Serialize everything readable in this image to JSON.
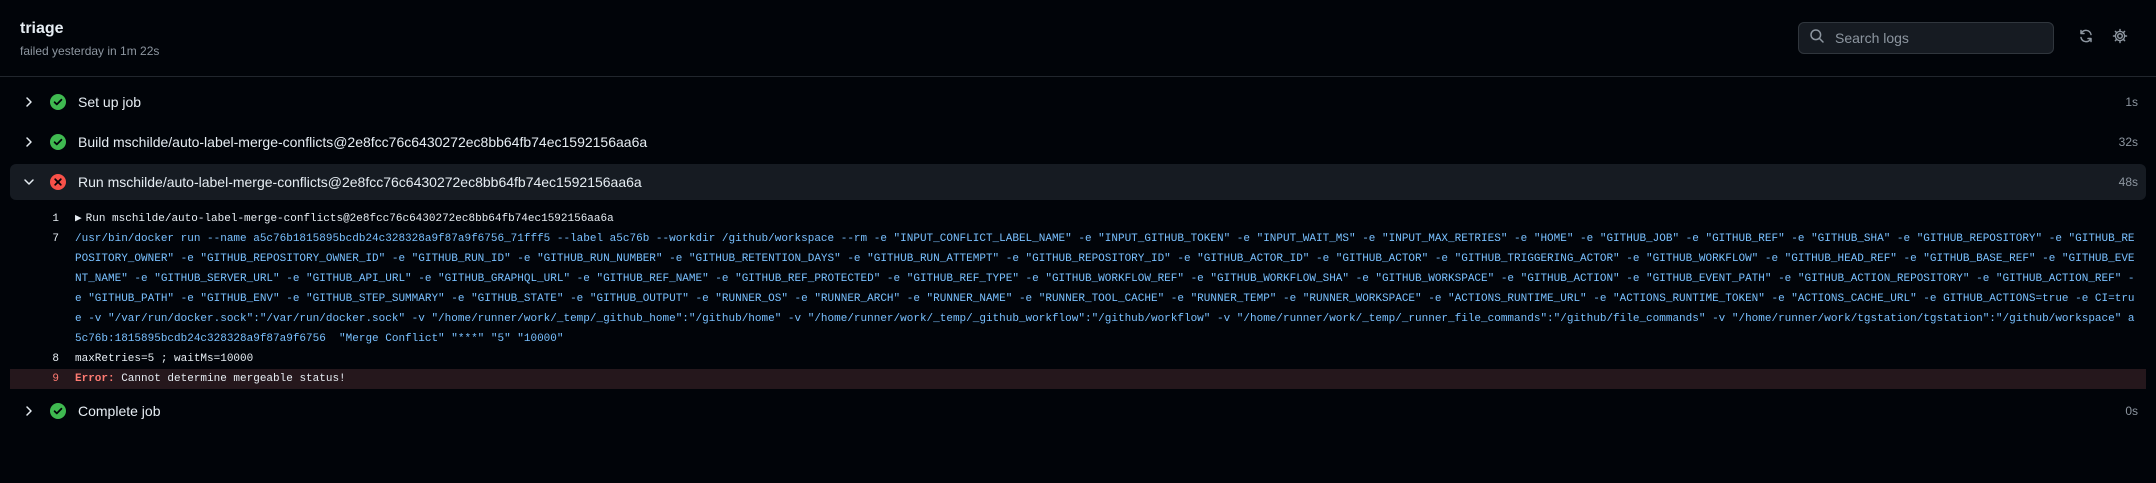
{
  "header": {
    "title": "triage",
    "subtitle": "failed yesterday in 1m 22s",
    "search_placeholder": "Search logs"
  },
  "steps": [
    {
      "name": "Set up job",
      "duration": "1s",
      "status": "success"
    },
    {
      "name": "Build mschilde/auto-label-merge-conflicts@2e8fcc76c6430272ec8bb64fb74ec1592156aa6a",
      "duration": "32s",
      "status": "success"
    },
    {
      "name": "Run mschilde/auto-label-merge-conflicts@2e8fcc76c6430272ec8bb64fb74ec1592156aa6a",
      "duration": "48s",
      "status": "failure"
    },
    {
      "name": "Complete job",
      "duration": "0s",
      "status": "success"
    }
  ],
  "log": {
    "line1_num": "1",
    "line1_arrow": "▶",
    "line1_text": "Run mschilde/auto-label-merge-conflicts@2e8fcc76c6430272ec8bb64fb74ec1592156aa6a",
    "line7_num": "7",
    "line7_text": "/usr/bin/docker run --name a5c76b1815895bcdb24c328328a9f87a9f6756_71fff5 --label a5c76b --workdir /github/workspace --rm -e \"INPUT_CONFLICT_LABEL_NAME\" -e \"INPUT_GITHUB_TOKEN\" -e \"INPUT_WAIT_MS\" -e \"INPUT_MAX_RETRIES\" -e \"HOME\" -e \"GITHUB_JOB\" -e \"GITHUB_REF\" -e \"GITHUB_SHA\" -e \"GITHUB_REPOSITORY\" -e \"GITHUB_REPOSITORY_OWNER\" -e \"GITHUB_REPOSITORY_OWNER_ID\" -e \"GITHUB_RUN_ID\" -e \"GITHUB_RUN_NUMBER\" -e \"GITHUB_RETENTION_DAYS\" -e \"GITHUB_RUN_ATTEMPT\" -e \"GITHUB_REPOSITORY_ID\" -e \"GITHUB_ACTOR_ID\" -e \"GITHUB_ACTOR\" -e \"GITHUB_TRIGGERING_ACTOR\" -e \"GITHUB_WORKFLOW\" -e \"GITHUB_HEAD_REF\" -e \"GITHUB_BASE_REF\" -e \"GITHUB_EVENT_NAME\" -e \"GITHUB_SERVER_URL\" -e \"GITHUB_API_URL\" -e \"GITHUB_GRAPHQL_URL\" -e \"GITHUB_REF_NAME\" -e \"GITHUB_REF_PROTECTED\" -e \"GITHUB_REF_TYPE\" -e \"GITHUB_WORKFLOW_REF\" -e \"GITHUB_WORKFLOW_SHA\" -e \"GITHUB_WORKSPACE\" -e \"GITHUB_ACTION\" -e \"GITHUB_EVENT_PATH\" -e \"GITHUB_ACTION_REPOSITORY\" -e \"GITHUB_ACTION_REF\" -e \"GITHUB_PATH\" -e \"GITHUB_ENV\" -e \"GITHUB_STEP_SUMMARY\" -e \"GITHUB_STATE\" -e \"GITHUB_OUTPUT\" -e \"RUNNER_OS\" -e \"RUNNER_ARCH\" -e \"RUNNER_NAME\" -e \"RUNNER_TOOL_CACHE\" -e \"RUNNER_TEMP\" -e \"RUNNER_WORKSPACE\" -e \"ACTIONS_RUNTIME_URL\" -e \"ACTIONS_RUNTIME_TOKEN\" -e \"ACTIONS_CACHE_URL\" -e GITHUB_ACTIONS=true -e CI=true -v \"/var/run/docker.sock\":\"/var/run/docker.sock\" -v \"/home/runner/work/_temp/_github_home\":\"/github/home\" -v \"/home/runner/work/_temp/_github_workflow\":\"/github/workflow\" -v \"/home/runner/work/_temp/_runner_file_commands\":\"/github/file_commands\" -v \"/home/runner/work/tgstation/tgstation\":\"/github/workspace\" a5c76b:1815895bcdb24c328328a9f87a9f6756  \"Merge Conflict\" \"***\" \"5\" \"10000\"",
    "line8_num": "8",
    "line8_text": "maxRetries=5 ; waitMs=10000",
    "line9_num": "9",
    "line9_label": "Error:",
    "line9_text": " Cannot determine mergeable status!"
  },
  "colors": {
    "success": "#3fb950",
    "failure": "#f85149",
    "command": "#79c0ff"
  },
  "icons": {
    "search": "search-icon",
    "refresh": "refresh-icon",
    "settings": "gear-icon",
    "success": "check-circle-icon",
    "failure": "x-circle-icon"
  }
}
